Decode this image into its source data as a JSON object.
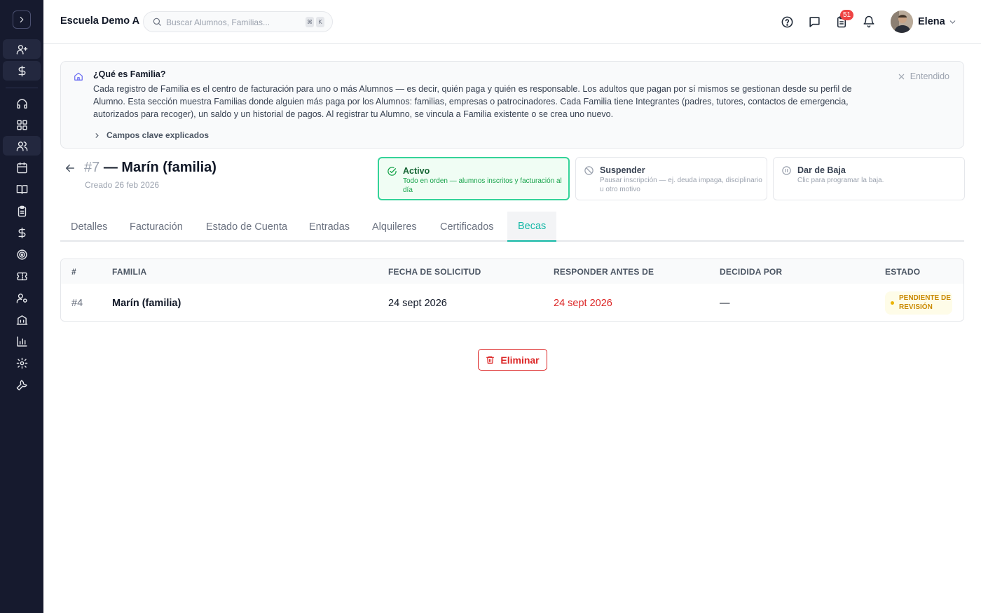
{
  "header": {
    "school_name": "Escuela Demo A",
    "search_placeholder": "Buscar Alumnos, Familias...",
    "shortcut_keys": [
      "⌘",
      "K"
    ],
    "notification_count": "51",
    "user_name": "Elena"
  },
  "sidebar": {
    "icons": [
      "chevron-right-icon",
      "user-plus-icon",
      "dollar-icon",
      "headset-icon",
      "dashboard-icon",
      "users-icon",
      "calendar-icon",
      "book-icon",
      "clipboard-icon",
      "dollar-icon",
      "target-icon",
      "ticket-icon",
      "user-cog-icon",
      "building-icon",
      "chart-icon",
      "settings-icon",
      "wrench-icon"
    ]
  },
  "info": {
    "title": "¿Qué es Familia?",
    "body": "Cada registro de Familia es el centro de facturación para uno o más Alumnos — es decir, quién paga y quién es responsable. Los adultos que pagan por sí mismos se gestionan desde su perfil de Alumno. Esta sección muestra Familias donde alguien más paga por los Alumnos: familias, empresas o patrocinadores. Cada Familia tiene Integrantes (padres, tutores, contactos de emergencia, autorizados para recoger), un saldo y un historial de pagos. Al registrar tu Alumno, se vincula a Familia existente o se crea uno nuevo.",
    "expand_label": "Campos clave explicados",
    "dismiss_label": "Entendido"
  },
  "record": {
    "id": "#7",
    "title": "— Marín (familia)",
    "created": "Creado 26 feb 2026"
  },
  "status_cards": [
    {
      "title": "Activo",
      "desc": "Todo en orden — alumnos inscritos y facturación al día",
      "active": true
    },
    {
      "title": "Suspender",
      "desc": "Pausar inscripción — ej. deuda impaga, disciplinario u otro motivo",
      "active": false
    },
    {
      "title": "Dar de Baja",
      "desc": "Clic para programar la baja.",
      "active": false
    }
  ],
  "tabs": [
    "Detalles",
    "Facturación",
    "Estado de Cuenta",
    "Entradas",
    "Alquileres",
    "Certificados",
    "Becas"
  ],
  "active_tab": "Becas",
  "table": {
    "headers": [
      "#",
      "FAMILIA",
      "FECHA DE SOLICITUD",
      "RESPONDER ANTES DE",
      "DECIDIDA POR",
      "ESTADO"
    ],
    "rows": [
      {
        "num": "#4",
        "family": "Marín (familia)",
        "requested": "24 sept 2026",
        "due": "24 sept 2026",
        "decided_by": "—",
        "status": "PENDIENTE DE REVISIÓN"
      }
    ]
  },
  "actions": {
    "delete_label": "Eliminar"
  },
  "colors": {
    "sidebar_bg": "#161a2e",
    "accent": "#14b8a6",
    "active_status": "#16a34a",
    "danger": "#dc2626",
    "pending": "#ca8a04"
  }
}
